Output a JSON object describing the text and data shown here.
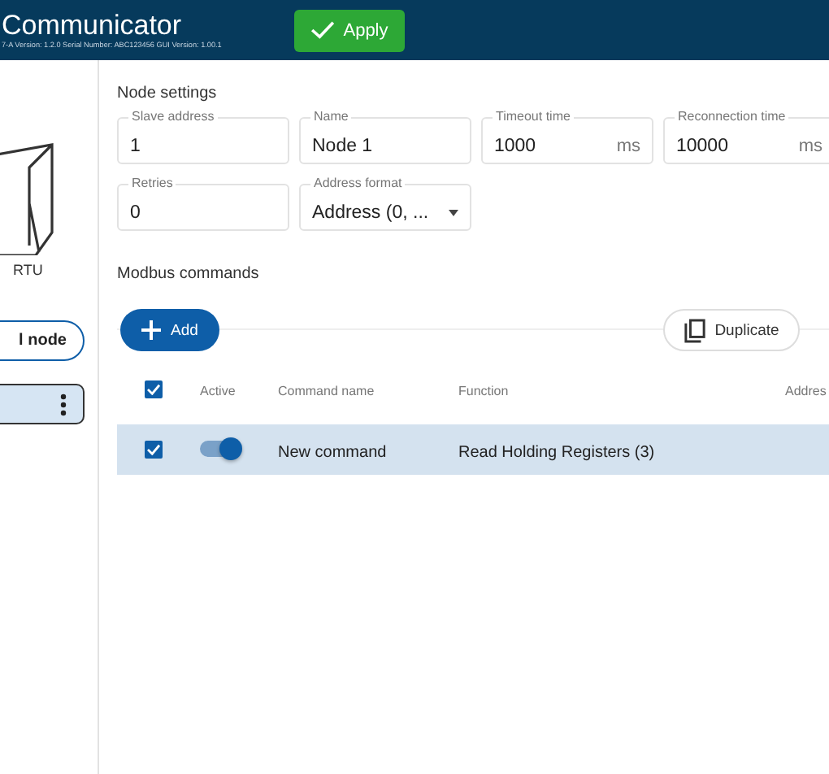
{
  "header": {
    "title": "Communicator",
    "subtitle": "7-A Version: 1.2.0 Serial Number: ABC123456 GUI Version: 1.00.1",
    "apply_button": "Apply"
  },
  "sidebar": {
    "device_label": "RTU",
    "node_button": "l node",
    "nodes": [
      {
        "selected": true
      }
    ]
  },
  "node_settings": {
    "title": "Node settings",
    "field_rows": [
      [
        {
          "kind": "text",
          "label": "Slave address",
          "value": "1"
        },
        {
          "kind": "text",
          "label": "Name",
          "value": "Node 1"
        },
        {
          "kind": "text",
          "label": "Timeout time",
          "value": "1000",
          "unit": "ms"
        },
        {
          "kind": "text",
          "label": "Reconnection time",
          "value": "10000",
          "unit": "ms"
        }
      ],
      [
        {
          "kind": "text",
          "label": "Retries",
          "value": "0"
        },
        {
          "kind": "select",
          "label": "Address format",
          "value": "Address (0, ..."
        }
      ]
    ]
  },
  "commands": {
    "title": "Modbus commands",
    "add_button": "Add",
    "duplicate_button": "Duplicate",
    "all_checked": true,
    "columns": [
      "Active",
      "Command name",
      "Function",
      "Addres"
    ],
    "rows": [
      {
        "checked": true,
        "selected": true,
        "active": true,
        "name": "New command",
        "function": "Read Holding Registers (3)"
      }
    ]
  }
}
